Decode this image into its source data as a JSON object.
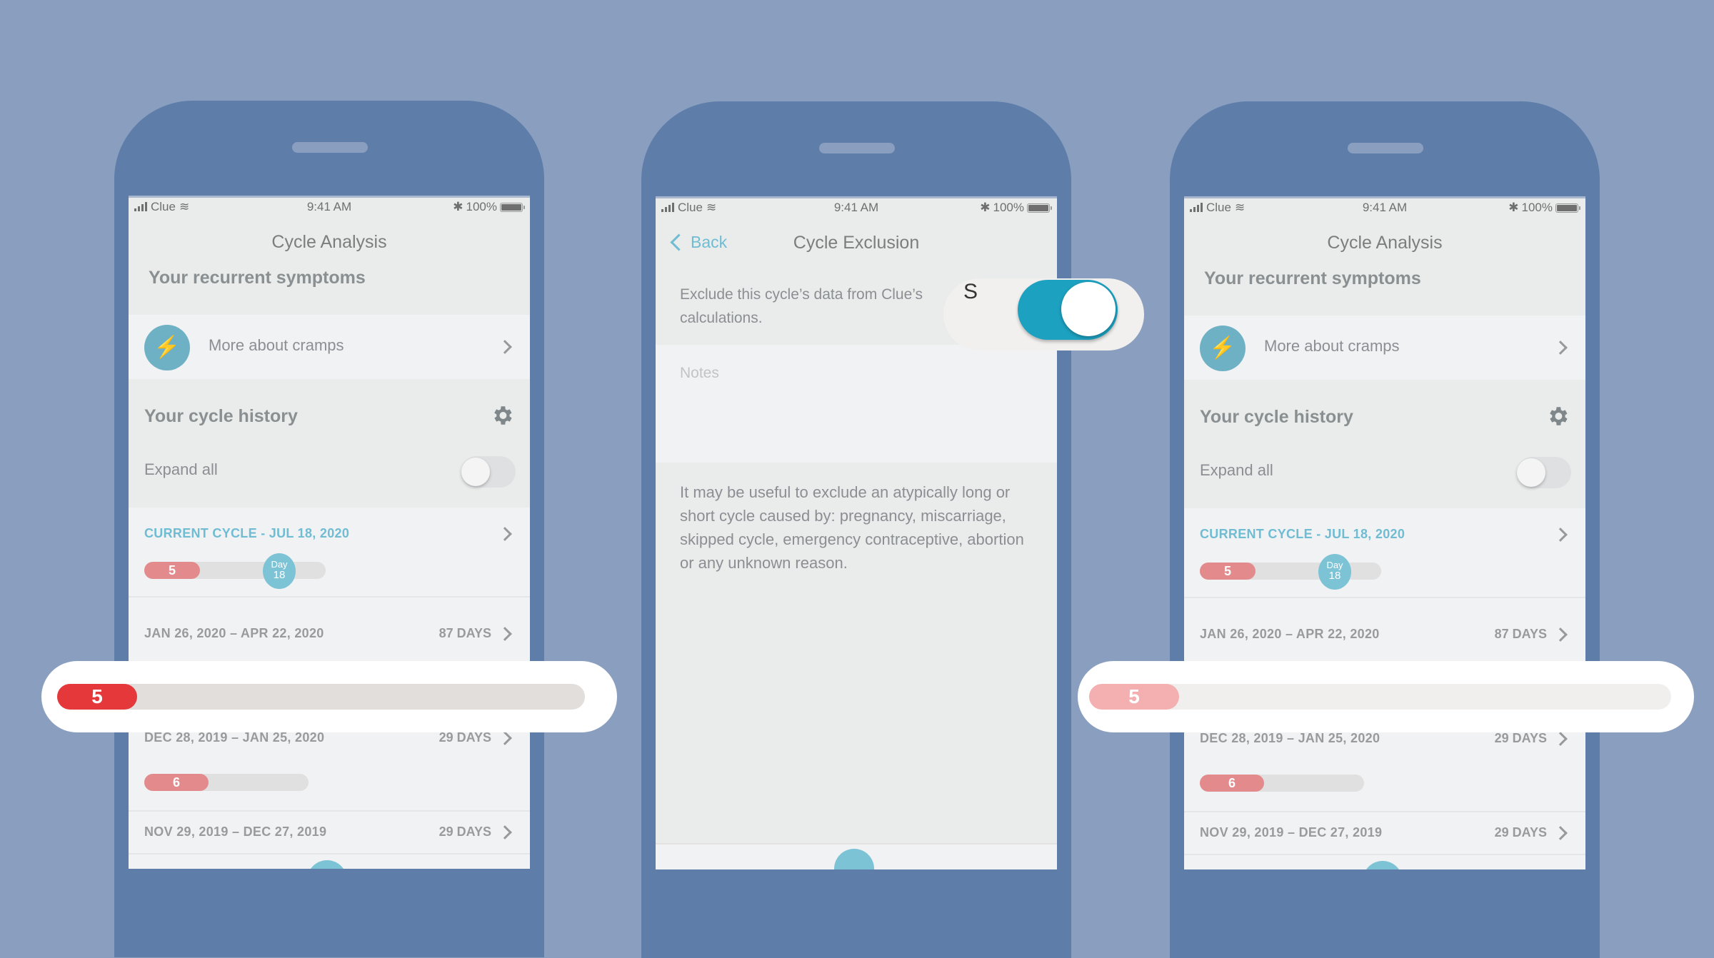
{
  "status_bar": {
    "carrier": "Clue",
    "time": "9:41 AM",
    "battery": "100%",
    "icons": [
      "signal-icon",
      "wifi-icon",
      "bluetooth-icon",
      "battery-icon"
    ]
  },
  "colors": {
    "background": "#8a9fc0",
    "phone_frame": "#5e7ea9",
    "accent_teal": "#6fbcd3",
    "period_red": "#e38b8c",
    "toggle_on": "#1da1c0",
    "callout_red_strong": "#e5383b",
    "callout_red_light": "#f4b0b1"
  },
  "phones": [
    {
      "title": "Cycle Analysis",
      "recurrent_section_title": "Your recurrent symptoms",
      "symptom_row": {
        "label": "More about cramps",
        "icon": "lightning-icon"
      },
      "history_section_title": "Your cycle history",
      "expand_all": {
        "label": "Expand all",
        "on": false
      },
      "cycles": [
        {
          "heading": "CURRENT CYCLE - JUL 18, 2020",
          "days": "",
          "period_days": "5",
          "current_day_label": "Day",
          "current_day": "18",
          "period_fraction": 0.3,
          "day_fraction": 0.75
        },
        {
          "heading": "JAN 26, 2020 – APR 22, 2020",
          "days": "87 DAYS",
          "period_days": "5"
        },
        {
          "heading": "DEC 28, 2019 – JAN 25, 2020",
          "days": "29 DAYS",
          "period_days": "6",
          "period_fraction": 0.4
        },
        {
          "heading": "NOV 29, 2019 – DEC 27, 2019",
          "days": "29 DAYS"
        }
      ],
      "callout_value": "5",
      "callout_fraction": 0.15
    },
    {
      "title": "Cycle Exclusion",
      "back_label": "Back",
      "exclude_text": "Exclude this cycle’s data from Clue’s calculations.",
      "exclude_toggle_on": true,
      "toggle_overlay_char": "S",
      "notes_placeholder": "Notes",
      "info_text": "It may be useful to exclude an atypically long or short cycle caused by: pregnancy, miscarriage, skipped cycle, emergency contraceptive, abortion or any unknown reason."
    },
    {
      "title": "Cycle Analysis",
      "recurrent_section_title": "Your recurrent symptoms",
      "symptom_row": {
        "label": "More about cramps",
        "icon": "lightning-icon"
      },
      "history_section_title": "Your cycle history",
      "expand_all": {
        "label": "Expand all",
        "on": false
      },
      "cycles": [
        {
          "heading": "CURRENT CYCLE - JUL 18, 2020",
          "days": "",
          "period_days": "5",
          "current_day_label": "Day",
          "current_day": "18"
        },
        {
          "heading": "JAN 26, 2020 – APR 22, 2020",
          "days": "87 DAYS",
          "period_days": "5"
        },
        {
          "heading": "DEC 28, 2019 – JAN 25, 2020",
          "days": "29 DAYS",
          "period_days": "6"
        },
        {
          "heading": "NOV 29, 2019 – DEC 27, 2019",
          "days": "29 DAYS"
        }
      ],
      "callout_value": "5",
      "callout_fraction": 0.15
    }
  ]
}
